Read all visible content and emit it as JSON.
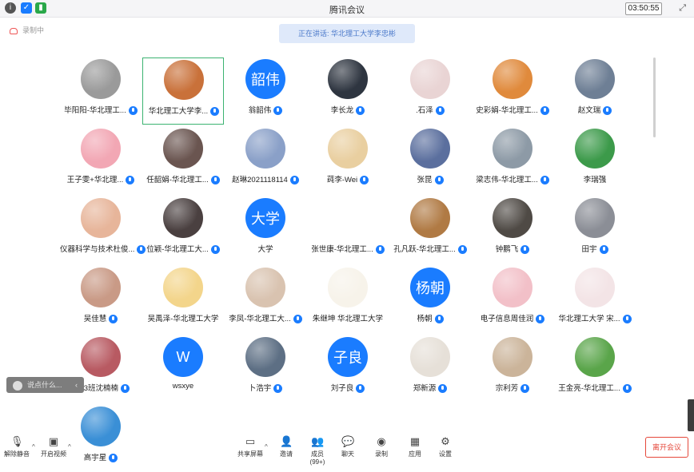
{
  "window": {
    "title": "腾讯会议",
    "timer": "03:50:55"
  },
  "recording_label": "录制中",
  "speaking_banner": "正在讲话: 华北理工大学李忠彬",
  "participants": [
    {
      "name": "毕阳阳-华北理工...",
      "avatar": "photo",
      "color": "#9a9a9a",
      "mic": true
    },
    {
      "name": "华北理工大学李...",
      "avatar": "photo",
      "color": "#c9713a",
      "mic": true,
      "active": true
    },
    {
      "name": "翁韶伟",
      "avatar": "text",
      "avatar_text": "韶伟",
      "mic": true
    },
    {
      "name": "李长龙",
      "avatar": "photo",
      "color": "#2e3540",
      "mic": true
    },
    {
      "name": ".石泽",
      "avatar": "photo",
      "color": "#e9d4d4",
      "mic": true
    },
    {
      "name": "史彩娟-华北理工...",
      "avatar": "photo",
      "color": "#e08a3c",
      "mic": true
    },
    {
      "name": "赵文瑞",
      "avatar": "photo",
      "color": "#6e7f95",
      "mic": true
    },
    {
      "name": "王子雯+华北理...",
      "avatar": "photo",
      "color": "#f2a7b4",
      "mic": true
    },
    {
      "name": "任韶娟-华北理工...",
      "avatar": "photo",
      "color": "#6a5550",
      "mic": true
    },
    {
      "name": "赵琳2021118114",
      "avatar": "photo",
      "color": "#8aa0c8",
      "mic": true
    },
    {
      "name": "莼李-Wei",
      "avatar": "photo",
      "color": "#e9cfa0",
      "mic": true
    },
    {
      "name": "张昆",
      "avatar": "photo",
      "color": "#5b6f9e",
      "mic": true
    },
    {
      "name": "梁志伟-华北理工...",
      "avatar": "photo",
      "color": "#8d9aa6",
      "mic": true
    },
    {
      "name": "李瑞强",
      "avatar": "photo",
      "color": "#3c9a4a",
      "mic": false
    },
    {
      "name": "仪器科学与技术杜俊...",
      "avatar": "photo",
      "color": "#e7b59a",
      "mic": true
    },
    {
      "name": "位颖-华北理工大...",
      "avatar": "photo",
      "color": "#4a4040",
      "mic": true
    },
    {
      "name": "大学",
      "avatar": "text",
      "avatar_text": "大学",
      "mic": false
    },
    {
      "name": "张世康-华北理工...",
      "avatar": "none",
      "mic": true
    },
    {
      "name": "孔凡跃-华北理工...",
      "avatar": "photo",
      "color": "#b07a44",
      "mic": true
    },
    {
      "name": "钟鹏飞",
      "avatar": "photo",
      "color": "#4f4a45",
      "mic": true
    },
    {
      "name": "田宇",
      "avatar": "photo",
      "color": "#8b8e96",
      "mic": true
    },
    {
      "name": "吴佳慧",
      "avatar": "photo",
      "color": "#c99a86",
      "mic": true
    },
    {
      "name": "吴禹泽-华北理工大学",
      "avatar": "photo",
      "color": "#f3d58b",
      "mic": false
    },
    {
      "name": "李凤-华北理工大...",
      "avatar": "photo",
      "color": "#d9c3b0",
      "mic": true
    },
    {
      "name": "朱继坤 华北理工大学",
      "avatar": "photo",
      "color": "#f7f3ea",
      "mic": false
    },
    {
      "name": "杨朝",
      "avatar": "text",
      "avatar_text": "杨朝",
      "mic": true
    },
    {
      "name": "电子信息周佳润",
      "avatar": "photo",
      "color": "#f2c0c8",
      "mic": true
    },
    {
      "name": "华北理工大学 宋...",
      "avatar": "photo",
      "color": "#f3e4e6",
      "mic": true
    },
    {
      "name": "研23班沈楠楠",
      "avatar": "photo",
      "color": "#b85a62",
      "mic": true
    },
    {
      "name": "wsxye",
      "avatar": "text",
      "avatar_text": "W",
      "mic": false
    },
    {
      "name": "卜浩宇",
      "avatar": "photo",
      "color": "#5d6f84",
      "mic": true
    },
    {
      "name": "刘子良",
      "avatar": "text",
      "avatar_text": "子良",
      "mic": true
    },
    {
      "name": "郑新源",
      "avatar": "photo",
      "color": "#e6e0d8",
      "mic": true
    },
    {
      "name": "宗利芳",
      "avatar": "photo",
      "color": "#cbb49a",
      "mic": true
    },
    {
      "name": "王金亮-华北理工...",
      "avatar": "photo",
      "color": "#5aa54a",
      "mic": true
    },
    {
      "name": "高宇星",
      "avatar": "photo",
      "color": "#3a8fd6",
      "mic": true
    }
  ],
  "chat_placeholder": "说点什么...",
  "toolbar": {
    "mute": "解除静音",
    "video": "开启视频",
    "share": "共享屏幕",
    "invite": "邀请",
    "members": "成员(99+)",
    "chat": "聊天",
    "record": "录制",
    "apps": "应用",
    "settings": "设置",
    "leave": "离开会议"
  }
}
